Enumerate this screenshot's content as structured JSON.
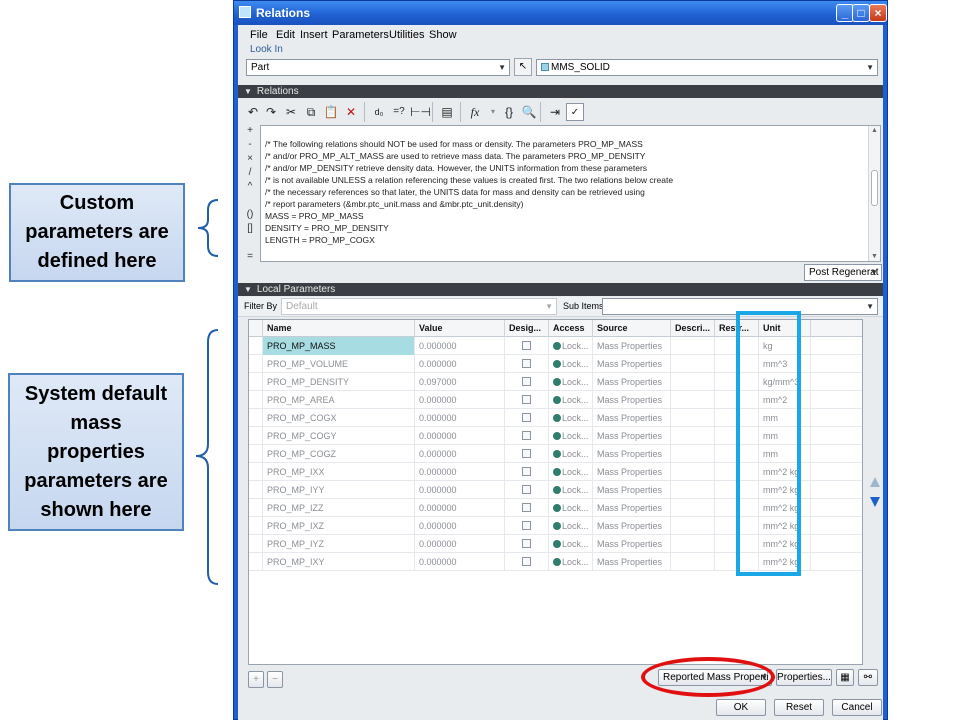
{
  "callouts": {
    "custom": "Custom\nparameters are\ndefined here",
    "system": "System default\nmass\nproperties\nparameters are\nshown here"
  },
  "window": {
    "title": "Relations",
    "menu": [
      "File",
      "Edit",
      "Insert",
      "Parameters",
      "Utilities",
      "Show"
    ],
    "look_in_label": "Look In",
    "look_in_value": "Part",
    "model_value": "MMS_SOLID"
  },
  "relations": {
    "section_label": "Relations",
    "lines": [
      "/* The following relations should NOT be used for mass or density. The parameters PRO_MP_MASS",
      "/* and/or  PRO_MP_ALT_MASS are used to retrieve mass data. The parameters PRO_MP_DENSITY",
      "/* and/or MP_DENSITY retrieve density data. However, the UNITS information from these parameters",
      "/* is not available UNLESS a relation referencing these values is created first. The two relations below create",
      "/* the necessary references so that later, the UNITS data for mass and density can be retrieved using",
      "/* report parameters (&mbr.ptc_unit.mass and &mbr.ptc_unit.density)",
      "MASS = PRO_MP_MASS",
      "DENSITY = PRO_MP_DENSITY",
      "LENGTH = PRO_MP_COGX"
    ],
    "side_tools": [
      "+",
      "-",
      "×",
      "/",
      "^",
      "",
      "()",
      "[]",
      "",
      "="
    ],
    "post_regen": "Post Regenerat"
  },
  "local_params": {
    "section_label": "Local Parameters",
    "filter_by_label": "Filter By",
    "filter_by_value": "Default",
    "sub_items_label": "Sub Items",
    "columns": [
      "Name",
      "Value",
      "Desig...",
      "Access",
      "Source",
      "Descri...",
      "Restr...",
      "Unit"
    ],
    "rows": [
      {
        "name": "PRO_MP_MASS",
        "value": "0.000000",
        "access": "Lock...",
        "source": "Mass Properties",
        "unit": "kg"
      },
      {
        "name": "PRO_MP_VOLUME",
        "value": "0.000000",
        "access": "Lock...",
        "source": "Mass Properties",
        "unit": "mm^3"
      },
      {
        "name": "PRO_MP_DENSITY",
        "value": "0.097000",
        "access": "Lock...",
        "source": "Mass Properties",
        "unit": "kg/mm^3"
      },
      {
        "name": "PRO_MP_AREA",
        "value": "0.000000",
        "access": "Lock...",
        "source": "Mass Properties",
        "unit": "mm^2"
      },
      {
        "name": "PRO_MP_COGX",
        "value": "0.000000",
        "access": "Lock...",
        "source": "Mass Properties",
        "unit": "mm"
      },
      {
        "name": "PRO_MP_COGY",
        "value": "0.000000",
        "access": "Lock...",
        "source": "Mass Properties",
        "unit": "mm"
      },
      {
        "name": "PRO_MP_COGZ",
        "value": "0.000000",
        "access": "Lock...",
        "source": "Mass Properties",
        "unit": "mm"
      },
      {
        "name": "PRO_MP_IXX",
        "value": "0.000000",
        "access": "Lock...",
        "source": "Mass Properties",
        "unit": "mm^2 kg"
      },
      {
        "name": "PRO_MP_IYY",
        "value": "0.000000",
        "access": "Lock...",
        "source": "Mass Properties",
        "unit": "mm^2 kg"
      },
      {
        "name": "PRO_MP_IZZ",
        "value": "0.000000",
        "access": "Lock...",
        "source": "Mass Properties",
        "unit": "mm^2 kg"
      },
      {
        "name": "PRO_MP_IXZ",
        "value": "0.000000",
        "access": "Lock...",
        "source": "Mass Properties",
        "unit": "mm^2 kg"
      },
      {
        "name": "PRO_MP_IYZ",
        "value": "0.000000",
        "access": "Lock...",
        "source": "Mass Properties",
        "unit": "mm^2 kg"
      },
      {
        "name": "PRO_MP_IXY",
        "value": "0.000000",
        "access": "Lock...",
        "source": "Mass Properties",
        "unit": "mm^2 kg"
      }
    ],
    "reported_mass": "Reported Mass Properti",
    "properties_btn": "Properties..."
  },
  "footer": {
    "ok": "OK",
    "reset": "Reset",
    "cancel": "Cancel"
  },
  "colors": {
    "highlight_box": "#1aa7e6",
    "ellipse": "#e01010",
    "selected_cell": "#a6dce2"
  }
}
